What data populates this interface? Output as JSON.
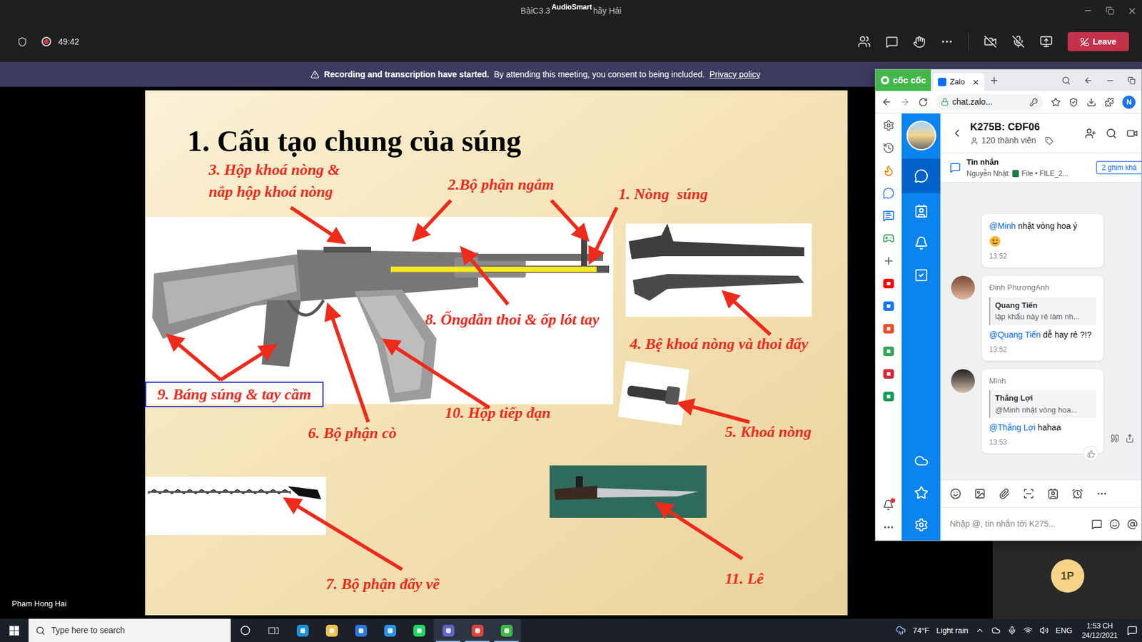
{
  "meeting": {
    "title_left": "BàiC3.3",
    "title_overlay": "AudioSmart",
    "title_right": "hầy Hải",
    "timer": "49:42",
    "recording": true,
    "camera_on": false,
    "mic_on": false,
    "leave": "Leave"
  },
  "banner": {
    "bold": "Recording and transcription have started.",
    "text": "By attending this meeting, you consent to being included.",
    "link": "Privacy policy"
  },
  "slide": {
    "title": "1. Cấu tạo chung của súng",
    "labels": [
      {
        "lines": [
          "1. Nòng  súng"
        ],
        "boxed": false
      },
      {
        "lines": [
          "2.Bộ phận ngắm"
        ],
        "boxed": false
      },
      {
        "lines": [
          "3. Hộp khoá nòng &",
          "nắp hộp khoá nòng"
        ],
        "boxed": false
      },
      {
        "lines": [
          "4. Bệ khoá nòng và thoi đẩy"
        ],
        "boxed": false
      },
      {
        "lines": [
          "5. Khoá nòng"
        ],
        "boxed": false
      },
      {
        "lines": [
          "6. Bộ phận cò"
        ],
        "boxed": false
      },
      {
        "lines": [
          "7. Bộ phận đẩy về"
        ],
        "boxed": false
      },
      {
        "lines": [
          "8. Ốngdẫn thoi & ốp lót tay"
        ],
        "boxed": false
      },
      {
        "lines": [
          "9. Báng súng & tay cầm"
        ],
        "boxed": true
      },
      {
        "lines": [
          "10. Hộp tiếp đạn"
        ],
        "boxed": false
      },
      {
        "lines": [
          "11. Lê"
        ],
        "boxed": false
      }
    ]
  },
  "presenter": "Pham Hong Hai",
  "participant_badge": "1P",
  "browser": {
    "brand": "cốc cốc",
    "tab": "Zalo",
    "address": "chat.zalo...",
    "profile": "N",
    "sidebar_alert": true
  },
  "zalo": {
    "group": "K275B: CĐF06",
    "members": "120 thành viên",
    "pinned": {
      "title": "Tin nhắn",
      "author": "Nguyễn Nhật:",
      "file": "File • FILE_2...",
      "button": "2 ghim khá"
    },
    "messages": [
      {
        "kind": "continuation",
        "sender": "",
        "quote_author": "",
        "quote_text": "",
        "mention": "@Minh",
        "text": " nhật vòng hoa ý",
        "time": "13:52",
        "hovered": false
      },
      {
        "kind": "with_sender",
        "sender": "Đinh PhươngAnh",
        "quote_author": "Quang Tiến",
        "quote_text": "lập khẩu này rẻ làm nh...",
        "mention": "@Quang Tiến",
        "text": " dễ hay rẻ ?!?",
        "time": "13:52",
        "hovered": false
      },
      {
        "kind": "with_sender",
        "sender": "Minh",
        "quote_author": "Thắng Lợi",
        "quote_text": "@Minh nhật vòng hoa...",
        "mention": "@Thắng Lợi",
        "text": " hahaa",
        "time": "13:53",
        "hovered": true
      }
    ],
    "input_placeholder": "Nhập @, tin nhắn tới K275..."
  },
  "taskbar": {
    "search_placeholder": "Type here to search",
    "apps": [
      {
        "color": "#1c8fd8",
        "running": false
      },
      {
        "color": "#f2c14e",
        "running": false
      },
      {
        "color": "#2a78d6",
        "running": false
      },
      {
        "color": "#2b94e6",
        "running": false
      },
      {
        "color": "#1ed760",
        "running": false
      },
      {
        "color": "#6264c7",
        "running": true
      },
      {
        "color": "#d9443f",
        "running": true
      },
      {
        "color": "#43b649",
        "running": true
      }
    ],
    "temperature": "74°F",
    "weather": "Light rain",
    "language": "ENG",
    "time": "1:53 CH",
    "date": "24/12/2021"
  }
}
